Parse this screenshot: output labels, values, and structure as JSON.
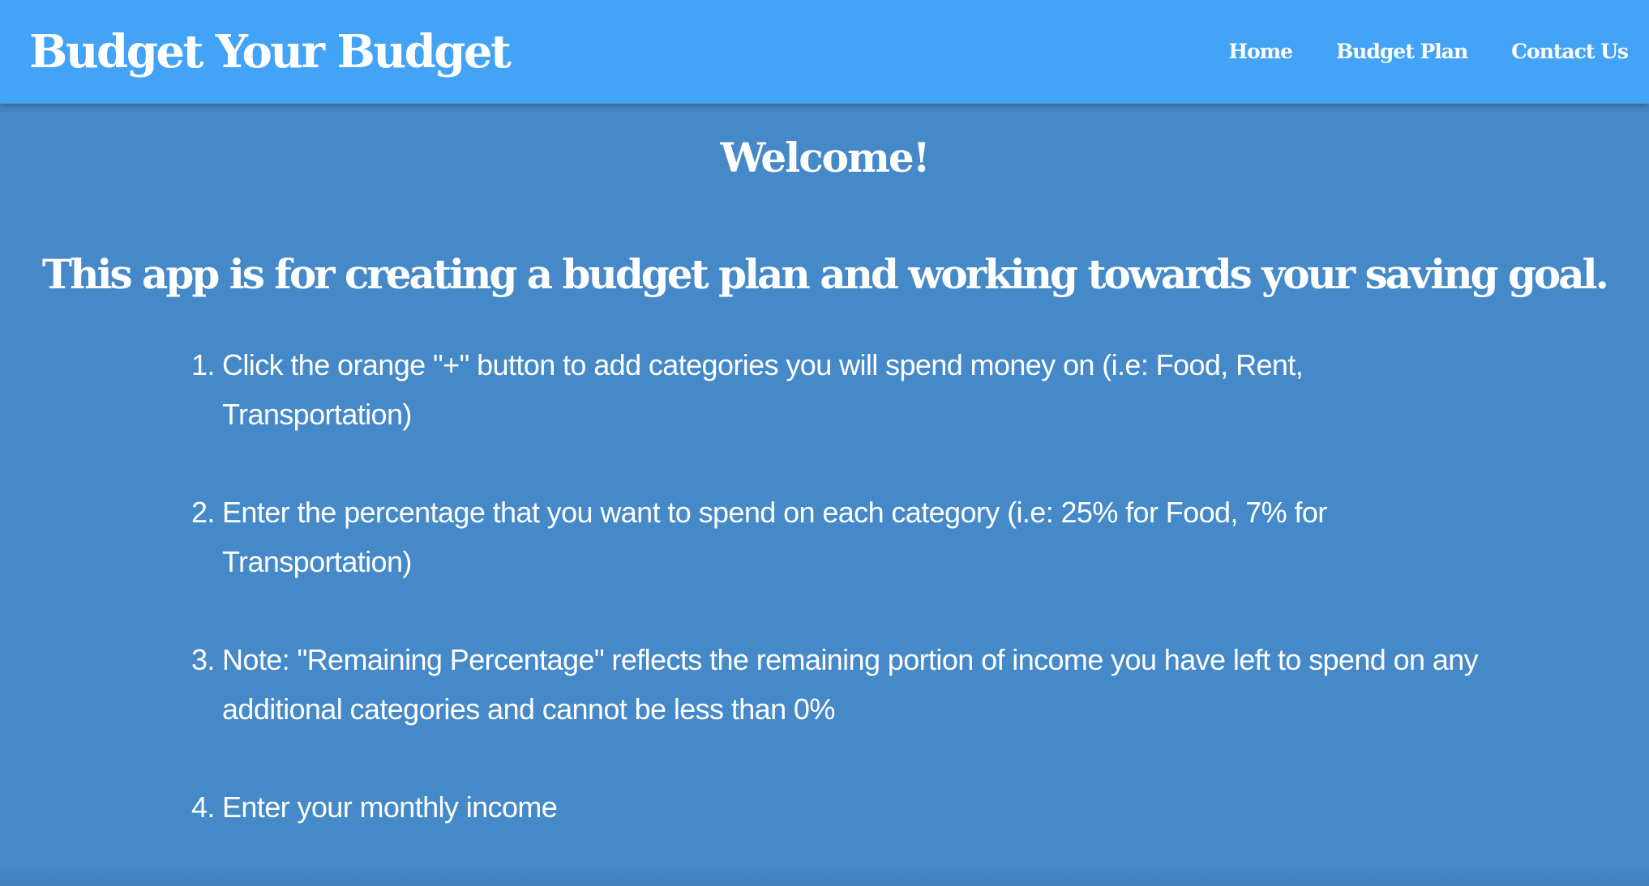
{
  "navbar": {
    "brand": "Budget Your Budget",
    "links": [
      "Home",
      "Budget Plan",
      "Contact Us"
    ]
  },
  "main": {
    "welcome": "Welcome!",
    "intro": "This app is for creating a budget plan and working towards your saving goal.",
    "steps": [
      {
        "number": "1.",
        "text": "Click the orange \"+\" button to add categories you will spend money on (i.e: Food, Rent, Transportation)"
      },
      {
        "number": "2.",
        "text": "Enter the percentage that you want to spend on each category (i.e: 25% for Food, 7% for Transportation)"
      },
      {
        "number": "3.",
        "text": "Note: \"Remaining Percentage\" reflects the remaining portion of income you have left to spend on any additional categories and cannot be less than 0%"
      },
      {
        "number": "4.",
        "text": "Enter your monthly income"
      }
    ]
  },
  "colors": {
    "navbar_background": "#43a3f7",
    "page_background": "#4589c8",
    "text": "#ffffff"
  }
}
